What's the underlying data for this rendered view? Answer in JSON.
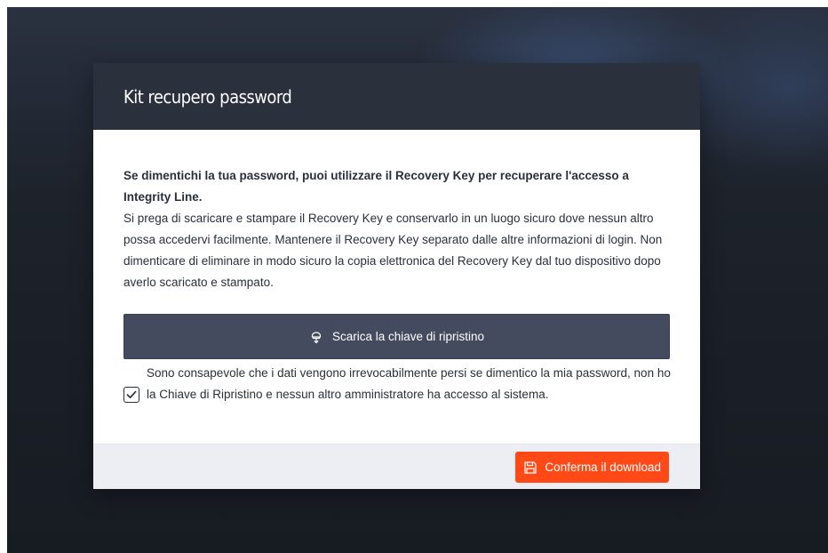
{
  "modal": {
    "title": "Kit recupero password",
    "intro_strong": "Se dimentichi la tua password, puoi utilizzare il Recovery Key per recuperare l'accesso a Integrity Line.",
    "intro_text": "Si prega di scaricare e stampare il Recovery Key e conservarlo in un luogo sicuro dove nessun altro possa accedervi facilmente. Mantenere il Recovery Key separato dalle altre informazioni di login. Non dimenticare di eliminare in modo sicuro la copia elettronica del Recovery Key dal tuo dispositivo dopo averlo scaricato e stampato.",
    "download_button": {
      "label": "Scarica la chiave di ripristino",
      "icon": "download-icon"
    },
    "acknowledgement": {
      "checked": true,
      "text": "Sono consapevole che i dati vengono irrevocabilmente persi se dimentico la mia password, non ho la Chiave di Ripristino e nessun altro amministratore ha accesso al sistema."
    },
    "confirm_button": {
      "label": "Conferma il download",
      "icon": "save-icon"
    }
  },
  "colors": {
    "header_bg": "#2b303d",
    "download_button_bg": "#454b5e",
    "confirm_button_bg": "#ff4a17",
    "footer_bg": "#eceef4"
  }
}
